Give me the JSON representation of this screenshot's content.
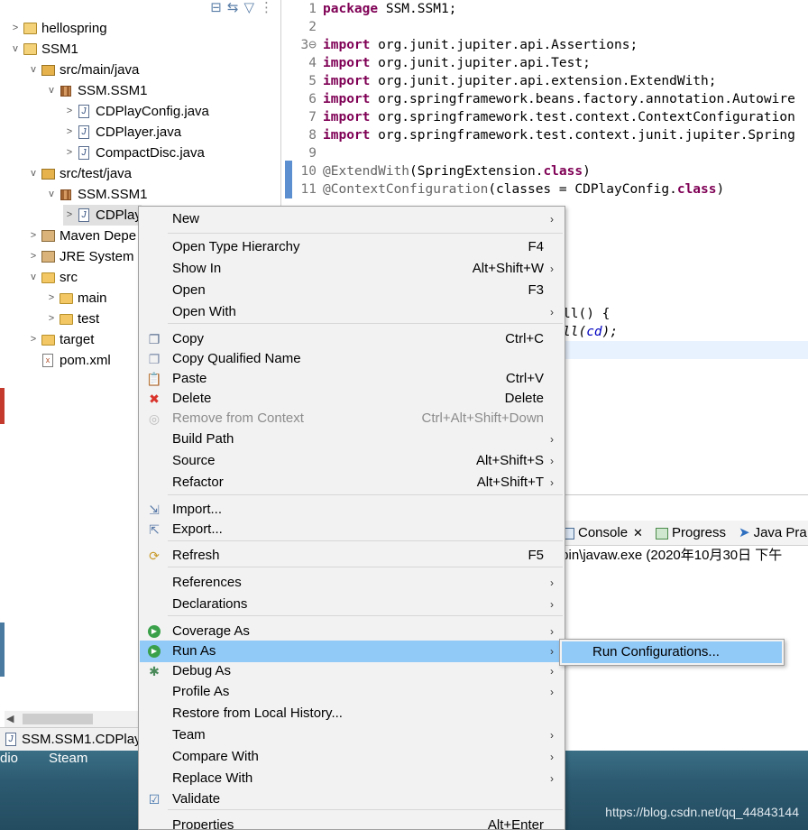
{
  "explorer": {
    "toolbar_icons": [
      "collapse-all-icon",
      "link-with-editor-icon",
      "filter-icon",
      "view-menu-icon"
    ],
    "tree": [
      {
        "label": "hellospring",
        "icon": "project-icon",
        "chevron": ">"
      },
      {
        "label": "SSM1",
        "icon": "project-icon",
        "chevron": "v"
      },
      {
        "label": "src/main/java",
        "icon": "source-folder-icon",
        "chevron": "v"
      },
      {
        "label": "SSM.SSM1",
        "icon": "package-icon",
        "chevron": "v"
      },
      {
        "label": "CDPlayConfig.java",
        "icon": "java-file-icon",
        "chevron": ">"
      },
      {
        "label": "CDPlayer.java",
        "icon": "java-file-icon",
        "chevron": ">"
      },
      {
        "label": "CompactDisc.java",
        "icon": "java-interface-icon",
        "chevron": ">"
      },
      {
        "label": "src/test/java",
        "icon": "source-folder-icon",
        "chevron": "v"
      },
      {
        "label": "SSM.SSM1",
        "icon": "package-icon",
        "chevron": "v"
      },
      {
        "label": "CDPlay",
        "icon": "java-file-icon",
        "chevron": ">"
      },
      {
        "label": "Maven Depe",
        "icon": "library-icon",
        "chevron": ">"
      },
      {
        "label": "JRE System",
        "icon": "library-icon",
        "chevron": ">"
      },
      {
        "label": "src",
        "icon": "folder-icon",
        "chevron": "v"
      },
      {
        "label": "main",
        "icon": "folder-icon",
        "chevron": ">"
      },
      {
        "label": "test",
        "icon": "folder-icon",
        "chevron": ">"
      },
      {
        "label": "target",
        "icon": "folder-icon",
        "chevron": ">"
      },
      {
        "label": "pom.xml",
        "icon": "xml-file-icon",
        "chevron": ""
      }
    ]
  },
  "status_bar": {
    "text": "SSM.SSM1.CDPlay"
  },
  "editor": {
    "lines": [
      {
        "num": "1",
        "text": "package SSM.SSM1;"
      },
      {
        "num": "2",
        "text": ""
      },
      {
        "num": "3⊖",
        "text": "import org.junit.jupiter.api.Assertions;"
      },
      {
        "num": "4",
        "text": "import org.junit.jupiter.api.Test;"
      },
      {
        "num": "5",
        "text": "import org.junit.jupiter.api.extension.ExtendWith;"
      },
      {
        "num": "6",
        "text": "import org.springframework.beans.factory.annotation.Autowire"
      },
      {
        "num": "7",
        "text": "import org.springframework.test.context.ContextConfiguration"
      },
      {
        "num": "8",
        "text": "import org.springframework.test.context.junit.jupiter.Spring"
      },
      {
        "num": "9",
        "text": ""
      },
      {
        "num": "10",
        "text": "@ExtendWith(SpringExtension.class)"
      },
      {
        "num": "11",
        "text": "@ContextConfiguration(classes = CDPlayConfig.class)"
      }
    ],
    "peek": {
      "l1": "ll() {",
      "l2": "ll(",
      "l2_field": "cd",
      "l2_end": ");"
    }
  },
  "console": {
    "tabs": [
      "Console",
      "Progress",
      "Java Pra"
    ],
    "path": "\\bin\\javaw.exe  (2020年10月30日 下午"
  },
  "desktop": {
    "labels": [
      "dio",
      "Steam"
    ],
    "watermark": "https://blog.csdn.net/qq_44843144"
  },
  "context_menu": {
    "items": [
      {
        "label": "New",
        "key": "",
        "submenu": true,
        "icon": ""
      },
      {
        "label": "Open Type Hierarchy",
        "key": "F4",
        "submenu": false,
        "icon": ""
      },
      {
        "label": "Show In",
        "key": "Alt+Shift+W",
        "submenu": true,
        "icon": ""
      },
      {
        "label": "Open",
        "key": "F3",
        "submenu": false,
        "icon": ""
      },
      {
        "label": "Open With",
        "key": "",
        "submenu": true,
        "icon": ""
      },
      {
        "label": "Copy",
        "key": "Ctrl+C",
        "submenu": false,
        "icon": "copy-icon"
      },
      {
        "label": "Copy Qualified Name",
        "key": "",
        "submenu": false,
        "icon": "copy-qualified-name-icon"
      },
      {
        "label": "Paste",
        "key": "Ctrl+V",
        "submenu": false,
        "icon": "paste-icon"
      },
      {
        "label": "Delete",
        "key": "Delete",
        "submenu": false,
        "icon": "delete-icon"
      },
      {
        "label": "Remove from Context",
        "key": "Ctrl+Alt+Shift+Down",
        "submenu": false,
        "icon": "remove-context-icon",
        "disabled": true
      },
      {
        "label": "Build Path",
        "key": "",
        "submenu": true,
        "icon": ""
      },
      {
        "label": "Source",
        "key": "Alt+Shift+S",
        "submenu": true,
        "icon": ""
      },
      {
        "label": "Refactor",
        "key": "Alt+Shift+T",
        "submenu": true,
        "icon": ""
      },
      {
        "label": "Import...",
        "key": "",
        "submenu": false,
        "icon": "import-icon"
      },
      {
        "label": "Export...",
        "key": "",
        "submenu": false,
        "icon": "export-icon"
      },
      {
        "label": "Refresh",
        "key": "F5",
        "submenu": false,
        "icon": "refresh-icon"
      },
      {
        "label": "References",
        "key": "",
        "submenu": true,
        "icon": ""
      },
      {
        "label": "Declarations",
        "key": "",
        "submenu": true,
        "icon": ""
      },
      {
        "label": "Coverage As",
        "key": "",
        "submenu": true,
        "icon": "coverage-icon"
      },
      {
        "label": "Run As",
        "key": "",
        "submenu": true,
        "icon": "run-icon",
        "highlighted": true
      },
      {
        "label": "Debug As",
        "key": "",
        "submenu": true,
        "icon": "debug-icon"
      },
      {
        "label": "Profile As",
        "key": "",
        "submenu": true,
        "icon": ""
      },
      {
        "label": "Restore from Local History...",
        "key": "",
        "submenu": false,
        "icon": ""
      },
      {
        "label": "Team",
        "key": "",
        "submenu": true,
        "icon": ""
      },
      {
        "label": "Compare With",
        "key": "",
        "submenu": true,
        "icon": ""
      },
      {
        "label": "Replace With",
        "key": "",
        "submenu": true,
        "icon": ""
      },
      {
        "label": "Validate",
        "key": "",
        "submenu": false,
        "icon": "checkbox-icon"
      },
      {
        "label": "Properties",
        "key": "Alt+Enter",
        "submenu": false,
        "icon": ""
      }
    ],
    "submenu": {
      "label": "Run Configurations..."
    }
  },
  "colors": {
    "highlight": "#91c9f7",
    "keyword": "#7f0055",
    "annotation": "#646464",
    "delete_icon": "#d9332b",
    "run_icon": "#3aa14a"
  }
}
